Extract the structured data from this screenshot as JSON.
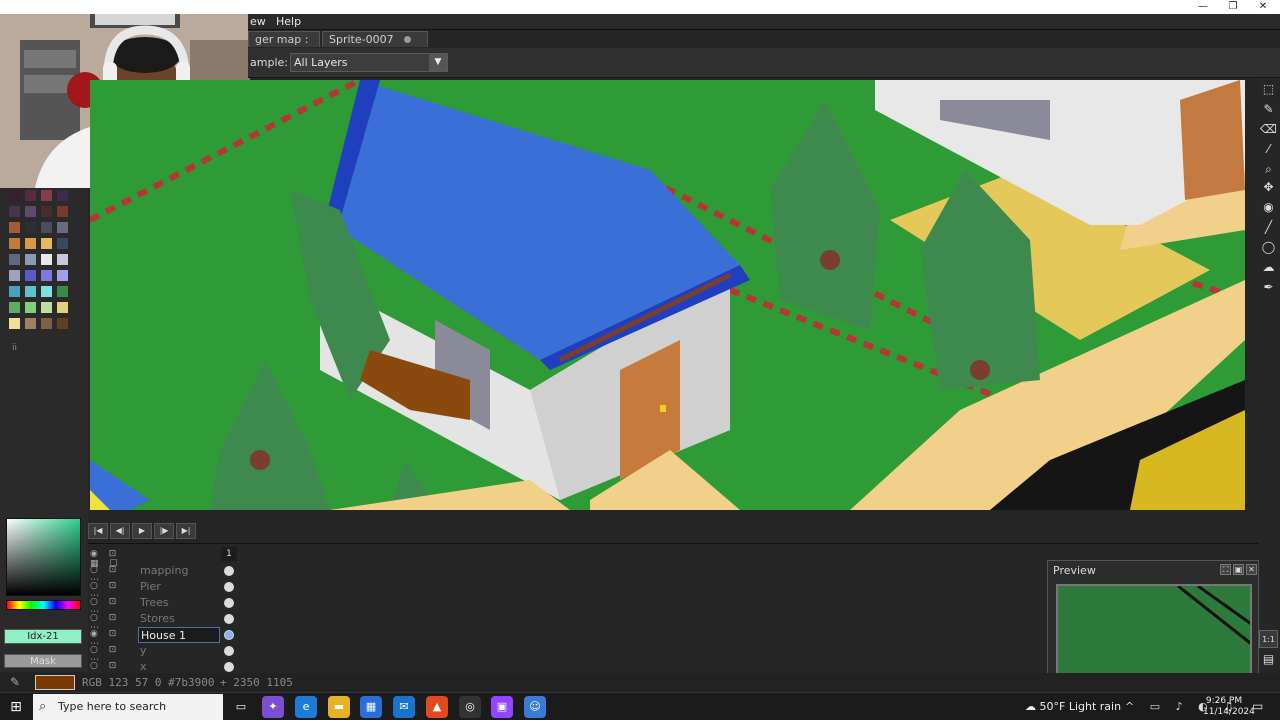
{
  "window": {
    "minimize": "—",
    "maximize": "❐",
    "close": "✕"
  },
  "menu": {
    "items": [
      "ew",
      "Help"
    ]
  },
  "tabs": [
    {
      "label": "ger map :"
    },
    {
      "label": "Sprite-0007"
    }
  ],
  "context_bar": {
    "sample_label": "ample:",
    "sample_value": "All Layers"
  },
  "palette": {
    "colors": [
      "#3a1e2e",
      "#5b2a3c",
      "#8a3a4e",
      "#3c2d4f",
      "#47364a",
      "#5e4a6d",
      "#4b2c2c",
      "#7a3a2a",
      "#a25a3a",
      "#2d2d3a",
      "#4c4c5e",
      "#6a6a80",
      "#c07a3a",
      "#d89a4a",
      "#e8b860",
      "#3a4a5e",
      "#5a6a80",
      "#8a9ab0",
      "#e8e8e8",
      "#c8c8d8",
      "#a0a0c0",
      "#5a5ad0",
      "#7a7ae0",
      "#a0a0f0",
      "#4aa0c0",
      "#60c0d0",
      "#80e0e0",
      "#3a8a4a",
      "#5ab060",
      "#80d080",
      "#c0e0a0",
      "#e0d080",
      "#f0e0a0",
      "#a08060",
      "#806040",
      "#604020"
    ]
  },
  "left_panel": {
    "idx": "Idx-21",
    "mask": "Mask",
    "pin": "ii"
  },
  "timeline": {
    "frame_number": "1",
    "layers": [
      {
        "name": "mapping",
        "active": false
      },
      {
        "name": "Pier",
        "active": false
      },
      {
        "name": "Trees",
        "active": false
      },
      {
        "name": "Stores",
        "active": false
      },
      {
        "name": "House 1",
        "active": true
      },
      {
        "name": "y",
        "active": false
      },
      {
        "name": "x",
        "active": false
      }
    ]
  },
  "playback": {
    "first": "|◀",
    "prev": "◀|",
    "play": "▶",
    "next": "|▶",
    "last": "▶|"
  },
  "preview": {
    "title": "Preview"
  },
  "right_tools": {
    "zoom_label": "1:1"
  },
  "status": {
    "rgb_text": "RGB 123 57 0 #7b3900",
    "position_text": "+ 2350 1105",
    "primary_color": "#7b3900"
  },
  "taskbar": {
    "search_placeholder": "Type here to search",
    "weather": "50°F  Light rain",
    "time": "9:26 PM",
    "date": "11/14/2024"
  },
  "colors": {
    "grass": "#2e9b36",
    "roof": "#3b6fd8",
    "roof_dark": "#1f3fbf",
    "wall": "#e6e6e6",
    "door": "#c67a3c",
    "road": "#f1d08a",
    "path_red": "#b83535",
    "tree": "#3e8a4e",
    "tree_dark": "#7a3e2e",
    "sand": "#e4c95a"
  }
}
